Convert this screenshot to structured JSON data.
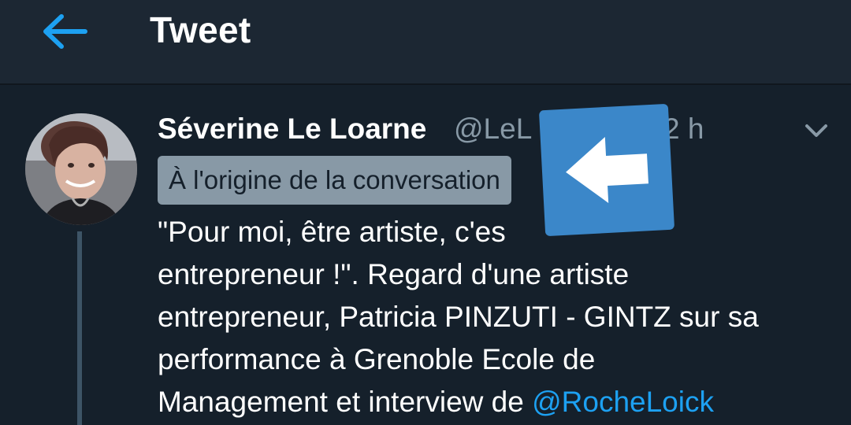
{
  "header": {
    "title": "Tweet",
    "back_icon": "arrow-left-icon",
    "accent_color": "#1da1f2",
    "background_color": "#1c2733"
  },
  "tweet": {
    "author_name": "Séverine Le Loarne",
    "author_handle": "@LeL",
    "time": "2 h",
    "options_icon": "chevron-down-icon",
    "origin_badge": "À l'origine de la conversation",
    "text_line_1_a": "\"Pour moi, être artiste, c'es",
    "text_line_2": "entrepreneur !\". Regard d'une artiste",
    "text_line_3": "entrepreneur, Patricia PINZUTI - GINTZ sur sa",
    "text_line_4": "performance à Grenoble Ecole de",
    "text_line_5_a": "Management et interview de ",
    "mention": "@RocheLoick"
  },
  "overlay": {
    "icon": "arrow-left-icon",
    "color": "#3b87c9"
  },
  "colors": {
    "background": "#15202b",
    "text_primary": "#ffffff",
    "text_secondary": "#8899a6",
    "link": "#1da1f2"
  }
}
